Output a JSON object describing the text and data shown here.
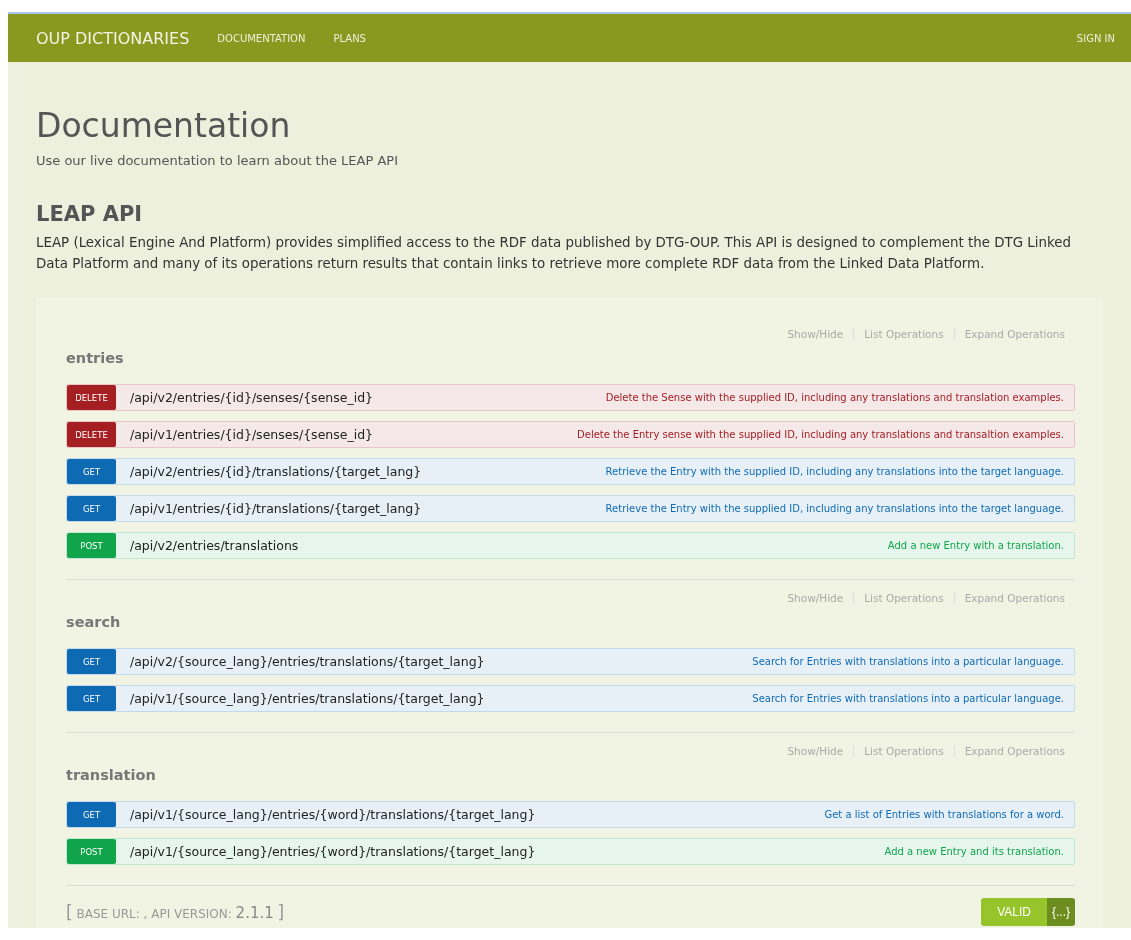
{
  "header": {
    "brand": "OUP DICTIONARIES",
    "nav": [
      {
        "label": "DOCUMENTATION"
      },
      {
        "label": "PLANS"
      }
    ],
    "sign_in": "SIGN IN"
  },
  "page": {
    "title": "Documentation",
    "subtitle": "Use our live documentation to learn about the LEAP API"
  },
  "api": {
    "title": "LEAP API",
    "description": "LEAP (Lexical Engine And Platform) provides simplified access to the RDF data published by DTG-OUP. This API is designed to complement the DTG Linked Data Platform and many of its operations return results that contain links to retrieve more complete RDF data from the Linked Data Platform."
  },
  "sections": [
    {
      "name": "entries",
      "actions": [
        "Show/Hide",
        "List Operations",
        "Expand Operations"
      ],
      "operations": [
        {
          "kind": "delete",
          "method": "DELETE",
          "path": "/api/v2/entries/{id}/senses/{sense_id}",
          "summary": "Delete the Sense with the supplied ID, including any translations and translation examples."
        },
        {
          "kind": "delete",
          "method": "DELETE",
          "path": "/api/v1/entries/{id}/senses/{sense_id}",
          "summary": "Delete the Entry sense with the supplied ID, including any translations and transaltion examples."
        },
        {
          "kind": "get",
          "method": "GET",
          "path": "/api/v2/entries/{id}/translations/{target_lang}",
          "summary": "Retrieve the Entry with the supplied ID, including any translations into the target language."
        },
        {
          "kind": "get",
          "method": "GET",
          "path": "/api/v1/entries/{id}/translations/{target_lang}",
          "summary": "Retrieve the Entry with the supplied ID, including any translations into the target language."
        },
        {
          "kind": "post",
          "method": "POST",
          "path": "/api/v2/entries/translations",
          "summary": "Add a new Entry with a translation."
        }
      ]
    },
    {
      "name": "search",
      "actions": [
        "Show/Hide",
        "List Operations",
        "Expand Operations"
      ],
      "operations": [
        {
          "kind": "get",
          "method": "GET",
          "path": "/api/v2/{source_lang}/entries/translations/{target_lang}",
          "summary": "Search for Entries with translations into a particular language."
        },
        {
          "kind": "get",
          "method": "GET",
          "path": "/api/v1/{source_lang}/entries/translations/{target_lang}",
          "summary": "Search for Entries with translations into a particular language."
        }
      ]
    },
    {
      "name": "translation",
      "actions": [
        "Show/Hide",
        "List Operations",
        "Expand Operations"
      ],
      "operations": [
        {
          "kind": "get",
          "method": "GET",
          "path": "/api/v1/{source_lang}/entries/{word}/translations/{target_lang}",
          "summary": "Get a list of Entries with translations for a word."
        },
        {
          "kind": "post",
          "method": "POST",
          "path": "/api/v1/{source_lang}/entries/{word}/translations/{target_lang}",
          "summary": "Add a new Entry and its translation."
        }
      ]
    }
  ],
  "footer": {
    "open": "[",
    "label": "BASE URL: , API VERSION:",
    "version": "2.1.1",
    "close": "]",
    "validator": {
      "label": "VALID",
      "badge": "{...}"
    }
  }
}
